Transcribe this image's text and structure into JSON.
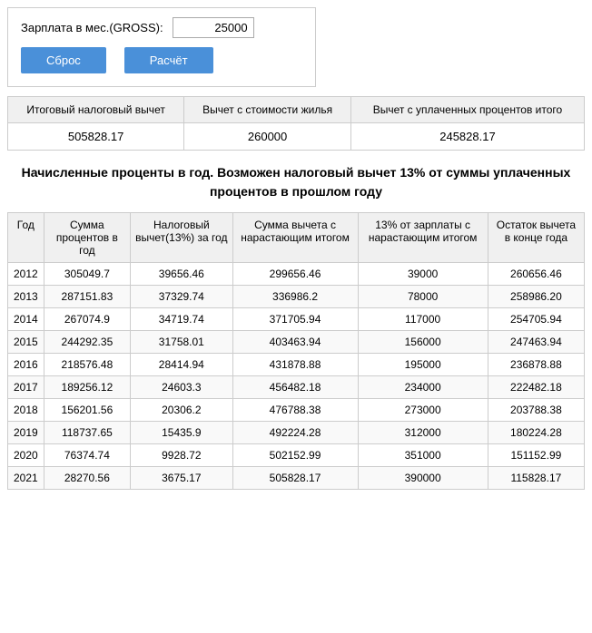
{
  "top": {
    "salary_label": "Зарплата в мес.(GROSS):",
    "salary_value": "25000",
    "reset_label": "Сброс",
    "calc_label": "Расчёт"
  },
  "summary": {
    "headers": [
      "Итоговый налоговый вычет",
      "Вычет с стоимости жилья",
      "Вычет с уплаченных процентов итого"
    ],
    "values": [
      "505828.17",
      "260000",
      "245828.17"
    ]
  },
  "description": "Начисленные проценты в год. Возможен налоговый вычет 13% от суммы уплаченных процентов в прошлом году",
  "table": {
    "headers": [
      "Год",
      "Сумма процентов в год",
      "Налоговый вычет(13%) за год",
      "Сумма вычета с нарастающим итогом",
      "13% от зарплаты с нарастающим итогом",
      "Остаток вычета в конце года"
    ],
    "rows": [
      [
        "2012",
        "305049.7",
        "39656.46",
        "299656.46",
        "39000",
        "260656.46"
      ],
      [
        "2013",
        "287151.83",
        "37329.74",
        "336986.2",
        "78000",
        "258986.20"
      ],
      [
        "2014",
        "267074.9",
        "34719.74",
        "371705.94",
        "117000",
        "254705.94"
      ],
      [
        "2015",
        "244292.35",
        "31758.01",
        "403463.94",
        "156000",
        "247463.94"
      ],
      [
        "2016",
        "218576.48",
        "28414.94",
        "431878.88",
        "195000",
        "236878.88"
      ],
      [
        "2017",
        "189256.12",
        "24603.3",
        "456482.18",
        "234000",
        "222482.18"
      ],
      [
        "2018",
        "156201.56",
        "20306.2",
        "476788.38",
        "273000",
        "203788.38"
      ],
      [
        "2019",
        "118737.65",
        "15435.9",
        "492224.28",
        "312000",
        "180224.28"
      ],
      [
        "2020",
        "76374.74",
        "9928.72",
        "502152.99",
        "351000",
        "151152.99"
      ],
      [
        "2021",
        "28270.56",
        "3675.17",
        "505828.17",
        "390000",
        "115828.17"
      ]
    ]
  }
}
